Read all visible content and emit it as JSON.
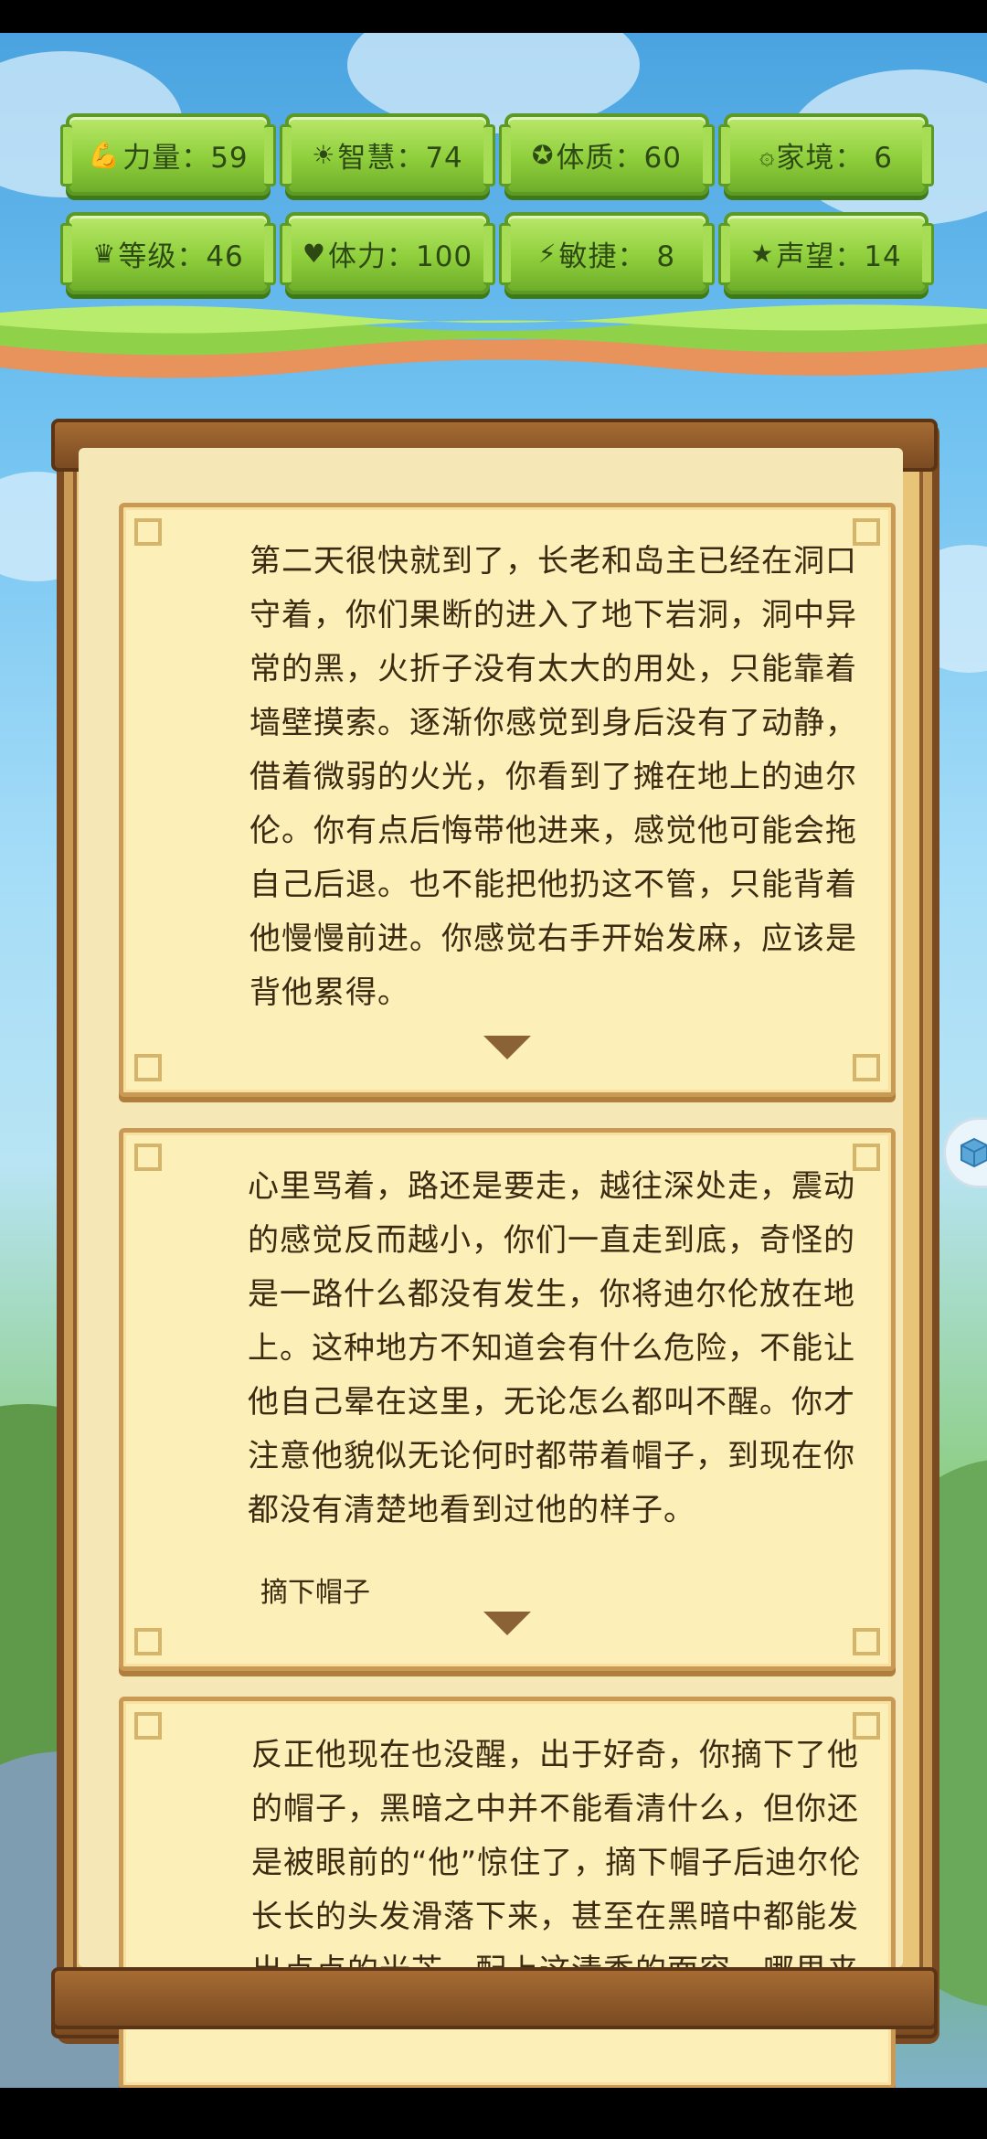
{
  "stats": [
    {
      "icon": "strength-icon",
      "glyph": "💪",
      "label": "力量：59"
    },
    {
      "icon": "wisdom-icon",
      "glyph": "☀",
      "label": "智慧：74"
    },
    {
      "icon": "constitution-icon",
      "glyph": "✪",
      "label": "体质：60"
    },
    {
      "icon": "family-icon",
      "glyph": "۞",
      "label": "家境： 6"
    },
    {
      "icon": "crown-icon",
      "glyph": "♛",
      "label": "等级：46"
    },
    {
      "icon": "heart-icon",
      "glyph": "♥",
      "label": "体力：100"
    },
    {
      "icon": "lightning-icon",
      "glyph": "⚡",
      "label": "敏捷： 8"
    },
    {
      "icon": "star-icon",
      "glyph": "★",
      "label": "声望：14"
    }
  ],
  "story": {
    "card1": "第二天很快就到了，长老和岛主已经在洞口守着，你们果断的进入了地下岩洞，洞中异常的黑，火折子没有太大的用处，只能靠着墙壁摸索。逐渐你感觉到身后没有了动静，借着微弱的火光，你看到了摊在地上的迪尔伦。你有点后悔带他进来，感觉他可能会拖自己后退。也不能把他扔这不管，只能背着他慢慢前进。你感觉右手开始发麻，应该是背他累得。",
    "card2": "心里骂着，路还是要走，越往深处走，震动的感觉反而越小，你们一直走到底，奇怪的是一路什么都没有发生，你将迪尔伦放在地上。这种地方不知道会有什么危险，不能让他自己晕在这里，无论怎么都叫不醒。你才注意他貌似无论何时都带着帽子，到现在你都没有清楚地看到过他的样子。",
    "card2_choice": "摘下帽子",
    "card3": "反正他现在也没醒，出于好奇，你摘下了他的帽子，黑暗之中并不能看清什么，但你还是被眼前的“他”惊住了，摘下帽子后迪尔伦长长的头发滑落下来，甚至在黑暗中都能发出点点的光芒，配上这清秀的面容，哪里来"
  },
  "colors": {
    "stat_green": "#8fcf3c",
    "frame_brown": "#7a4a22",
    "card_bg": "#fcf0b8",
    "text": "#3d2a12"
  }
}
